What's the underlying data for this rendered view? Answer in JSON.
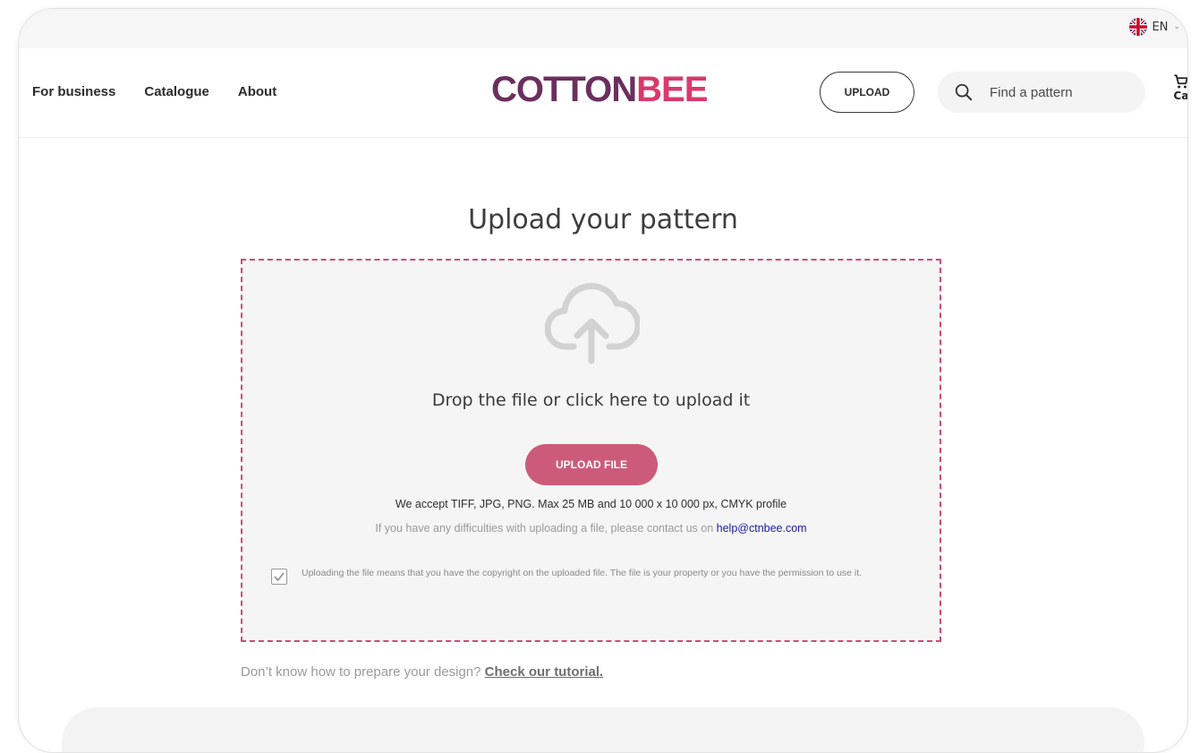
{
  "topbar": {
    "language": "EN"
  },
  "nav": {
    "items": [
      "For business",
      "Catalogue",
      "About"
    ]
  },
  "logo": {
    "part1": "COTTON",
    "part2": "BEE"
  },
  "header": {
    "upload_label": "UPLOAD",
    "search_placeholder": "Find a pattern",
    "cart_label": "Ca"
  },
  "main": {
    "title": "Upload your pattern",
    "dropzone": {
      "drop_text": "Drop the file or click here to upload it",
      "upload_file_label": "UPLOAD FILE",
      "accept_text": "We accept TIFF, JPG, PNG. Max 25 MB and 10 000 x 10 000 px, CMYK profile",
      "contact_text": "If you have any difficulties with uploading a file, please contact us on ",
      "contact_email": "help@ctnbee.com",
      "consent_text": "Uploading the file means that you have the copyright on the uploaded file. The file is your property or you have the permission to use it.",
      "consent_checked": true
    },
    "tutorial": {
      "prompt": "Don’t know how to prepare your design? ",
      "link": "Check our tutorial."
    }
  },
  "colors": {
    "accent": "#cc5b79",
    "dash_border": "#cf4c73",
    "logo_cotton": "#6b2f5e",
    "logo_bee": "#d83a6b",
    "link": "#1a1aa6"
  },
  "icons": {
    "flag": "uk-flag-icon",
    "search": "search-icon",
    "cart": "cart-icon",
    "cloud": "cloud-upload-icon",
    "check": "checkmark-icon"
  }
}
